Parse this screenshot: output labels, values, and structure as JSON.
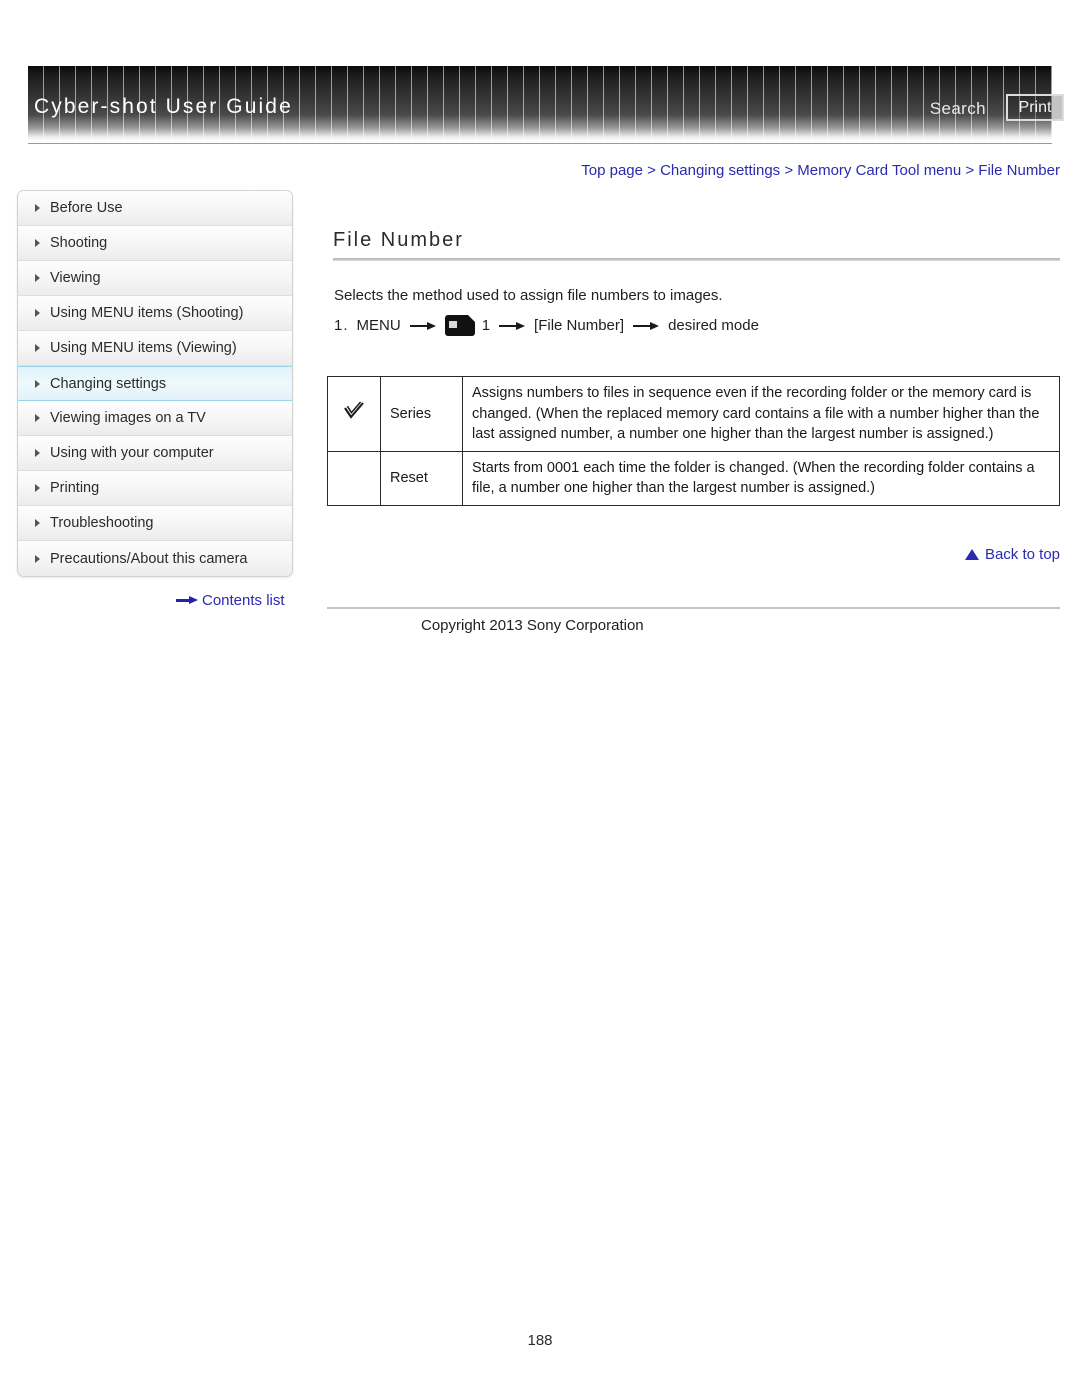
{
  "header": {
    "title": "Cyber-shot User Guide",
    "search_label": "Search",
    "print_label": "Print"
  },
  "sidebar": {
    "items": [
      {
        "label": "Before Use",
        "active": false
      },
      {
        "label": "Shooting",
        "active": false
      },
      {
        "label": "Viewing",
        "active": false
      },
      {
        "label": "Using MENU items (Shooting)",
        "active": false
      },
      {
        "label": "Using MENU items (Viewing)",
        "active": false
      },
      {
        "label": "Changing settings",
        "active": true
      },
      {
        "label": "Viewing images on a TV",
        "active": false
      },
      {
        "label": "Using with your computer",
        "active": false
      },
      {
        "label": "Printing",
        "active": false
      },
      {
        "label": "Troubleshooting",
        "active": false
      },
      {
        "label": "Precautions/About this camera",
        "active": false
      }
    ],
    "contents_list_label": "Contents list"
  },
  "main": {
    "breadcrumb": "Top page > Changing settings > Memory Card Tool menu > File Number",
    "title": "File Number",
    "intro": "Selects the method used to assign file numbers to images.",
    "step": {
      "number": "1.",
      "menu_label": "MENU",
      "icon_name": "memory-card-tool-menu-icon",
      "tab_number": "1",
      "item_label": "[File Number]",
      "result_label": "desired mode"
    },
    "options_table": {
      "rows": [
        {
          "checked": true,
          "name": "Series",
          "description": "Assigns numbers to files in sequence even if the recording folder or the memory card is changed. (When the replaced memory card contains a file with a number higher than the last assigned number, a number one higher than the largest number is assigned.)"
        },
        {
          "checked": false,
          "name": "Reset",
          "description": "Starts from 0001 each time the folder is changed. (When the recording folder contains a file, a number one higher than the largest number is assigned.)"
        }
      ]
    },
    "back_to_top_label": "Back to top"
  },
  "footer": {
    "copyright": "Copyright 2013 Sony Corporation",
    "page_number": "188"
  },
  "colors": {
    "link": "#2a2ab0",
    "header_dark": "#1b1b1b",
    "active_nav": "#dff3fb"
  }
}
